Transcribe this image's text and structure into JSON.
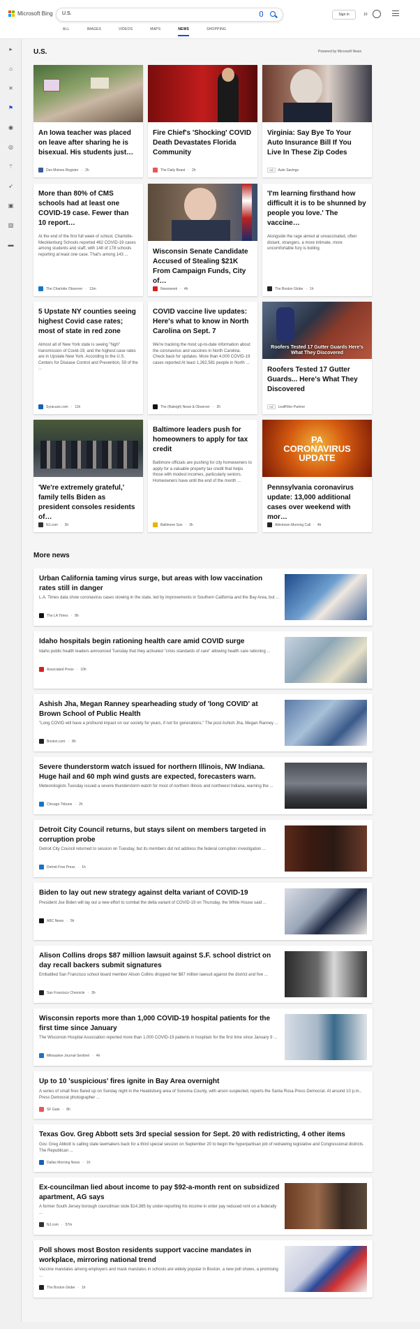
{
  "header": {
    "brand": "Microsoft Bing",
    "query": "U.S.",
    "signin": "Sign in",
    "rewards_count": "10",
    "tabs": [
      "ALL",
      "IMAGES",
      "VIDEOS",
      "MAPS",
      "NEWS",
      "SHOPPING"
    ],
    "active_tab": "NEWS"
  },
  "section": {
    "title": "U.S.",
    "powered_by": "Powered by Microsoft News"
  },
  "cards": [
    {
      "title": "An Iowa teacher was placed on leave after sharing he is bisexual. His students just…",
      "snippet": "",
      "source": "Des Moines Register",
      "time": "2h",
      "ad": "",
      "fav": "#3b5b99"
    },
    {
      "title": "Fire Chief's 'Shocking' COVID Death Devastates Florida Community",
      "snippet": "",
      "source": "The Daily Beast",
      "time": "2h",
      "ad": "",
      "fav": "#e85757"
    },
    {
      "title": "Virginia: Say Bye To Your Auto Insurance Bill If You Live In These Zip Codes",
      "snippet": "",
      "source": "Auto Savings",
      "time": "",
      "ad": "Ad",
      "fav": ""
    },
    {
      "title": "More than 80% of CMS schools had at least one COVID-19 case. Fewer than 10 report…",
      "snippet": "At the end of the first full week of school, Charlotte-Mecklenburg Schools reported 462 COVID-19 cases among students and staff, with 148 of 178 schools reporting at least one case. That's among 143 ...",
      "source": "The Charlotte Observer",
      "time": "13m",
      "ad": "",
      "fav": "#1a73c7"
    },
    {
      "title": "Wisconsin Senate Candidate Accused of Stealing $21K From Campaign Funds, City of…",
      "snippet": "",
      "source": "Newsweek",
      "time": "4h",
      "ad": "",
      "fav": "#d42020"
    },
    {
      "title": "'I'm learning firsthand how difficult it is to be shunned by people you love.' The vaccine…",
      "snippet": "Alongside the rage aimed at unvaccinated, often distant, strangers, a more intimate, more uncomfortable fury is boiling.",
      "source": "The Boston Globe",
      "time": "1h",
      "ad": "",
      "fav": "#222"
    },
    {
      "title": "5 Upstate NY counties seeing highest Covid case rates; most of state in red zone",
      "snippet": "Almost all of New York state is seeing \"high\" transmission of Covid-19, and the highest case rates are in Upstate New York. According to the U.S. Centers for Disease Control and Prevention, 59 of the ...",
      "source": "Syracuse.com",
      "time": "11h",
      "ad": "",
      "fav": "#1a5fb4"
    },
    {
      "title": "COVID vaccine live updates: Here's what to know in North Carolina on Sept. 7",
      "snippet": "We're tracking the most up-to-date information about the coronavirus and vaccines in North Carolina. Check back for updates. More than 4,000 COVID-19 cases reported At least 1,262,581 people in North ...",
      "source": "The (Raleigh) News & Observer",
      "time": "2h",
      "ad": "",
      "fav": "#111"
    },
    {
      "title": "Roofers Tested 17 Gutter Guards... Here's What They Discovered",
      "snippet": "",
      "source": "LeafFilter Partner",
      "time": "",
      "ad": "Ad",
      "fav": ""
    },
    {
      "title": "'We're extremely grateful,' family tells Biden as president consoles residents of…",
      "snippet": "",
      "source": "NJ.com",
      "time": "3h",
      "ad": "",
      "fav": "#333"
    },
    {
      "title": "Baltimore leaders push for homeowners to apply for tax credit",
      "snippet": "Baltimore officials are pushing for city homeowners to apply for a valuable property tax credit that helps those with modest incomes, particularly seniors. Homeowners have until the end of the month ...",
      "source": "Baltimore Sun",
      "time": "3h",
      "ad": "",
      "fav": "#e8b400"
    },
    {
      "title": "Pennsylvania coronavirus update: 13,000 additional cases over weekend with mor…",
      "snippet": "",
      "source": "Allentown Morning Call",
      "time": "4h",
      "ad": "",
      "fav": "#222"
    }
  ],
  "roof_overlay": "Roofers Tested 17 Gutter Guards Here's What They Discovered",
  "pa_overlay": "PA CORONAVIRUS UPDATE",
  "more_news": {
    "title": "More news",
    "items": [
      {
        "title": "Urban California taming virus surge, but areas with low vaccination rates still in danger",
        "snippet": "L.A. Times data show coronavirus cases slowing in the state, led by improvements in Southern California and the Bay Area, but ...",
        "source": "The LA Times",
        "time": "8h",
        "fav": "#111"
      },
      {
        "title": "Idaho hospitals begin rationing health care amid COVID surge",
        "snippet": "Idaho public health leaders announced Tuesday that they activated \"crisis standards of care\" allowing health care rationing ...",
        "source": "Associated Press",
        "time": "10h",
        "fav": "#d42020"
      },
      {
        "title": "Ashish Jha, Megan Ranney spearheading study of 'long COVID' at Brown School of Public Health",
        "snippet": "\"Long COVID will have a profound impact on our society for years, if not for generations.\" The post Ashish Jha, Megan Ranney ...",
        "source": "Boston.com",
        "time": "8h",
        "fav": "#222"
      },
      {
        "title": "Severe thunderstorm watch issued for northern Illinois, NW Indiana. Huge hail and 60 mph wind gusts are expected, forecasters warn.",
        "snippet": "Meteorologists Tuesday issued a severe thunderstorm watch for most of northern Illinois and northwest Indiana, warning the ...",
        "source": "Chicago Tribune",
        "time": "2h",
        "fav": "#1a73c7"
      },
      {
        "title": "Detroit City Council returns, but stays silent on members targeted in corruption probe",
        "snippet": "Detroit City Council returned to session on Tuesday, but its members did not address the federal corruption investigation ...",
        "source": "Detroit Free Press",
        "time": "1h",
        "fav": "#1a73c7"
      },
      {
        "title": "Biden to lay out new strategy against delta variant of COVID-19",
        "snippet": "President Joe Biden will lay out a new effort to combat the delta variant of COVID-19 on Thursday, the White House said ...",
        "source": "ABC News",
        "time": "5h",
        "fav": "#111"
      },
      {
        "title": "Alison Collins drops $87 million lawsuit against S.F. school district on day recall backers submit signatures",
        "snippet": "Embattled San Francisco school board member Alison Collins dropped her $87 million lawsuit against the district and five ...",
        "source": "San Francisco Chronicle",
        "time": "3h",
        "fav": "#222"
      },
      {
        "title": "Wisconsin reports more than 1,000 COVID-19 hospital patients for the first time since January",
        "snippet": "The Wisconsin Hospital Association reported more than 1,000 COVID-19 patients in hospitals for the first time since January 9 ...",
        "source": "Milwaukee Journal-Sentinel",
        "time": "4h",
        "fav": "#1a73c7"
      },
      {
        "title": "Up to 10 'suspicious' fires ignite in Bay Area overnight",
        "snippet": "A series of small fires flared up on Sunday night in the Healdsburg area of Sonoma County, with arson suspected, reports the Santa Rosa Press Democrat. At around 10 p.m., Press Democrat photographer ...",
        "source": "SF Gate",
        "time": "8h",
        "fav": "#e85757"
      },
      {
        "title": "Texas Gov. Greg Abbott sets 3rd special session for Sept. 20 with redistricting, 4 other items",
        "snippet": "Gov. Greg Abbott is calling state lawmakers back for a third special session on September 20 to begin the hyperpartisan job of redrawing legislative and Congressional districts. The Republican ...",
        "source": "Dallas Morning News",
        "time": "1h",
        "fav": "#1a5fb4"
      },
      {
        "title": "Ex-councilman lied about income to pay $92-a-month rent on subsidized apartment, AG says",
        "snippet": "A former South Jersey borough councilman stole $14,385 by under-reporting his income in order pay reduced rent on a federally ...",
        "source": "NJ.com",
        "time": "57m",
        "fav": "#333"
      },
      {
        "title": "Poll shows most Boston residents support vaccine mandates in workplace, mirroring national trend",
        "snippet": "Vaccine mandates among employers and mask mandates in schools are widely popular in Boston, a new poll shows, a promising ...",
        "source": "The Boston Globe",
        "time": "1h",
        "fav": "#222"
      }
    ]
  }
}
